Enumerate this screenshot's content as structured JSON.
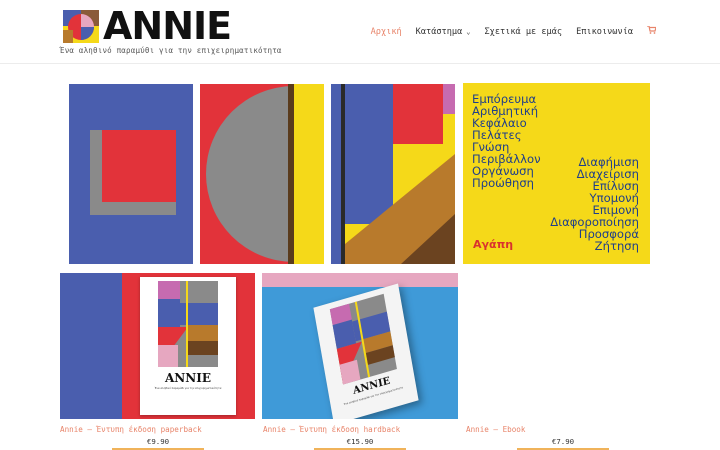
{
  "brand": {
    "name": "ANNIE",
    "tagline": "Ένα αληθινό παραμύθι για την επιχειρηματικότητα"
  },
  "nav": {
    "items": [
      {
        "label": "Αρχική",
        "active": true
      },
      {
        "label": "Κατάστημα",
        "has_dropdown": true
      },
      {
        "label": "Σχετικά με εμάς"
      },
      {
        "label": "Επικοινωνία"
      }
    ],
    "cart_icon": "cart-icon"
  },
  "hero": {
    "words_left": [
      "Εμπόρευμα",
      "Αριθμητική",
      "Κεφάλαιο",
      "Πελάτες",
      "Γνώση",
      "Περιβάλλον",
      "Οργάνωση",
      "Προώθηση"
    ],
    "words_right": [
      "Διαφήμιση",
      "Διαχείριση",
      "Επίλυση",
      "Υπομονή",
      "Επιμονή",
      "Διαφοροποίηση",
      "Προσφορά",
      "Ζήτηση"
    ],
    "highlight": "Αγάπη"
  },
  "products": [
    {
      "title": "Annie – Έντυπη έκδοση paperback",
      "price": "€9.90"
    },
    {
      "title": "Annie – Έντυπη έκδοση hardback",
      "price": "€15.90"
    },
    {
      "title": "Annie – Ebook",
      "price": "€7.90"
    }
  ],
  "book_cover": {
    "title": "ANNIE",
    "subtitle": "Ένα αληθινό παραμύθι για την επιχειρηματικότητα"
  },
  "colors": {
    "accent": "#e8846a",
    "blue": "#4a5eae",
    "red": "#e2333a",
    "yellow": "#f5d919",
    "gray": "#8a8a8a",
    "brown": "#b87a2c"
  }
}
